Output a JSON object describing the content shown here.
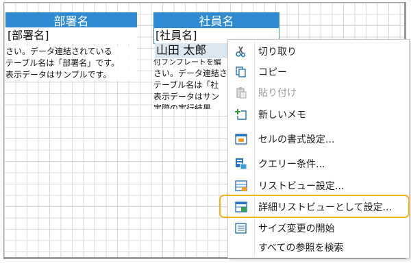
{
  "table": {
    "col1_header": "部署名",
    "col2_header": "社員名",
    "col1_field": "[部署名]",
    "col2_field": "[社員名]",
    "col1_lines": [
      "さい。データ連結されている",
      "テーブル名は「部署名」です。",
      "表示データはサンプルです。"
    ],
    "sample_value": "山田 太郎",
    "col2_lines": [
      "付フンプレートを編",
      "さい。データ連結さ",
      "テーブル名は「社",
      "表示データはサン",
      "実際の実行結果"
    ]
  },
  "context_menu": {
    "items": [
      {
        "label": "切り取り",
        "icon": "scissors-icon",
        "disabled": false
      },
      {
        "label": "コピー",
        "icon": "copy-icon",
        "disabled": false
      },
      {
        "label": "貼り付け",
        "icon": "paste-icon",
        "disabled": true
      },
      {
        "label": "新しいメモ",
        "icon": "new-note-icon",
        "disabled": false
      },
      {
        "label": "セルの書式設定...",
        "icon": "format-cells-icon",
        "disabled": false
      },
      {
        "label": "クエリー条件...",
        "icon": "query-icon",
        "disabled": false
      },
      {
        "label": "リストビュー設定...",
        "icon": "listview-icon",
        "disabled": false
      },
      {
        "label": "詳細リストビューとして設定...",
        "icon": "detail-listview-icon",
        "disabled": false,
        "highlighted": true
      },
      {
        "label": "サイズ変更の開始",
        "icon": "resize-icon",
        "disabled": false
      },
      {
        "label": "すべての参照を検索",
        "icon": "",
        "disabled": false
      }
    ]
  },
  "colors": {
    "header": "#2f8ad2",
    "highlight": "#f2b31a",
    "grid": "#d9d9d9"
  }
}
